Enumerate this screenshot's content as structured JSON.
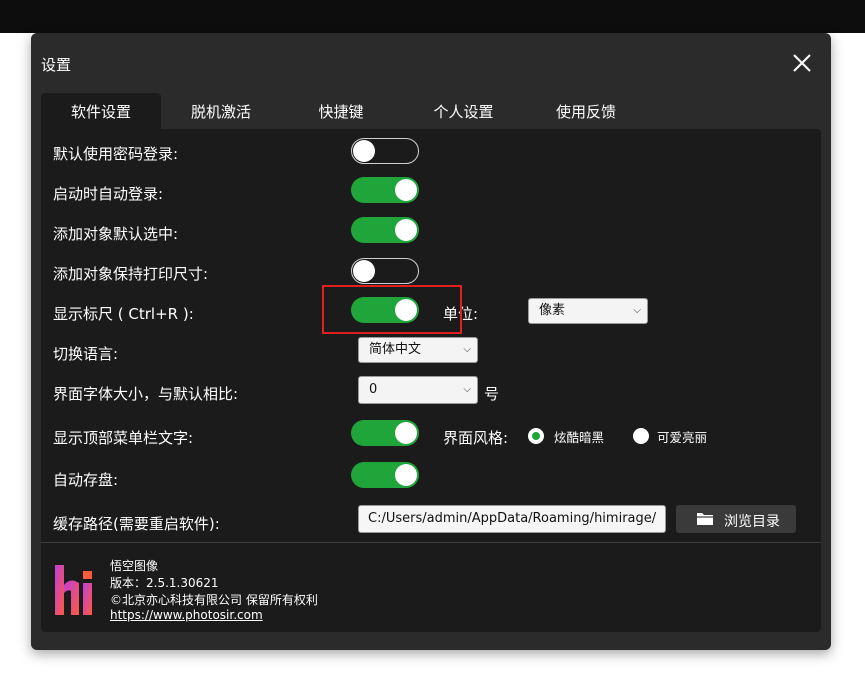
{
  "dialog": {
    "title": "设置",
    "close_icon": "close-icon"
  },
  "tabs": [
    {
      "label": "软件设置",
      "active": true
    },
    {
      "label": "脱机激活",
      "active": false
    },
    {
      "label": "快捷键",
      "active": false
    },
    {
      "label": "个人设置",
      "active": false
    },
    {
      "label": "使用反馈",
      "active": false
    }
  ],
  "settings": {
    "password_login": {
      "label": "默认使用密码登录:",
      "on": false
    },
    "auto_login": {
      "label": "启动时自动登录:",
      "on": true
    },
    "select_on_add": {
      "label": "添加对象默认选中:",
      "on": true
    },
    "keep_print_size": {
      "label": "添加对象保持打印尺寸:",
      "on": false
    },
    "show_ruler": {
      "label": "显示标尺 ( Ctrl+R ):",
      "on": true
    },
    "unit": {
      "label": "单位:",
      "value": "像素"
    },
    "language": {
      "label": "切换语言:",
      "value": "简体中文"
    },
    "font_size": {
      "label": "界面字体大小，与默认相比:",
      "value": "0",
      "suffix": "号"
    },
    "menu_text": {
      "label": "显示顶部菜单栏文字:",
      "on": true
    },
    "ui_style": {
      "label": "界面风格:",
      "options": [
        {
          "label": "炫酷暗黑",
          "selected": true
        },
        {
          "label": "可爱亮丽",
          "selected": false
        }
      ]
    },
    "autosave": {
      "label": "自动存盘:",
      "on": true
    },
    "cache_path": {
      "label": "缓存路径(需要重启软件):",
      "value": "C:/Users/admin/AppData/Roaming/himirage/",
      "browse_label": "浏览目录",
      "browse_icon": "folder-icon"
    }
  },
  "about": {
    "app_name": "悟空图像",
    "version": "版本：2.5.1.30621",
    "copyright": "©北京亦心科技有限公司 保留所有权利",
    "url": "https://www.photosir.com",
    "logo_letter": "hi"
  },
  "colors": {
    "accent": "#1fa53a",
    "highlight": "#e02020",
    "dialog_bg": "#2b2b2b",
    "panel_bg": "#1b1b1b"
  }
}
